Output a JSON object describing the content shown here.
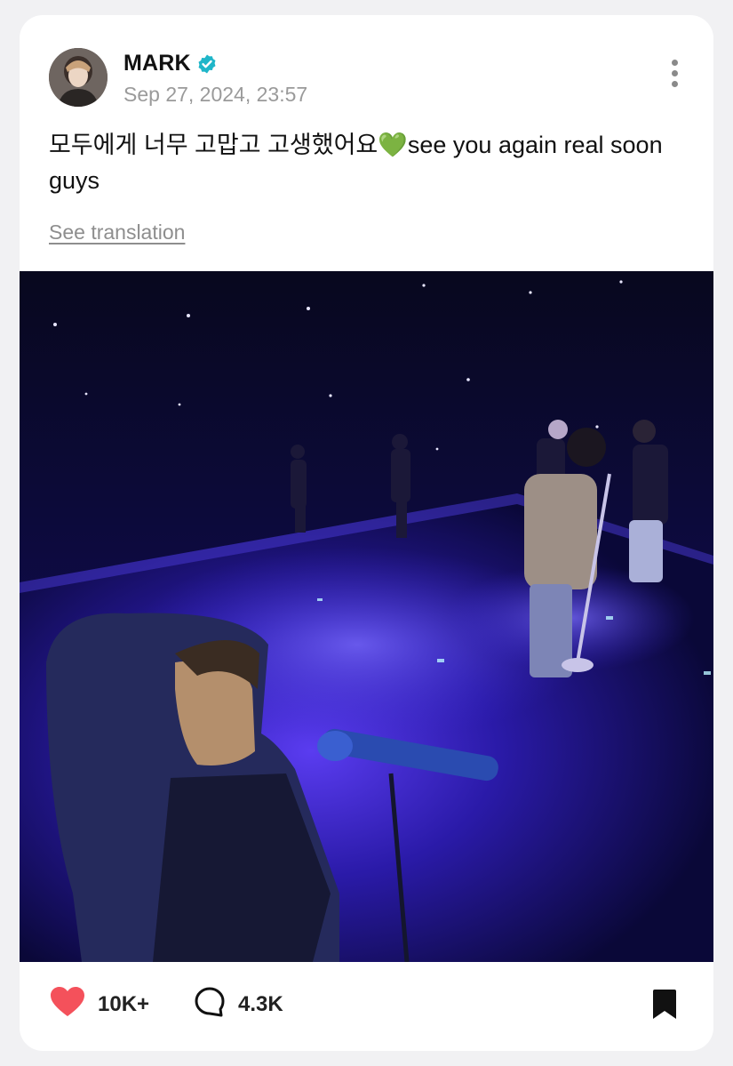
{
  "post": {
    "author": {
      "name": "MARK",
      "verified": true,
      "avatar_icon": "profile-photo"
    },
    "date": "Sep 27, 2024, 23:57",
    "text": "모두에게 너무 고맙고 고생했어요💚see you again real soon guys",
    "translate_label": "See translation",
    "image": {
      "description_icon": "concert-stage-photo"
    }
  },
  "actions": {
    "like_count": "10K+",
    "comment_count": "4.3K",
    "like_icon": "heart-icon",
    "comment_icon": "comment-bubble-icon",
    "bookmark_icon": "bookmark-icon"
  },
  "colors": {
    "verified": "#1fb6c9",
    "heart": "#f4515b",
    "stage_blue": "#3d2ad8"
  }
}
